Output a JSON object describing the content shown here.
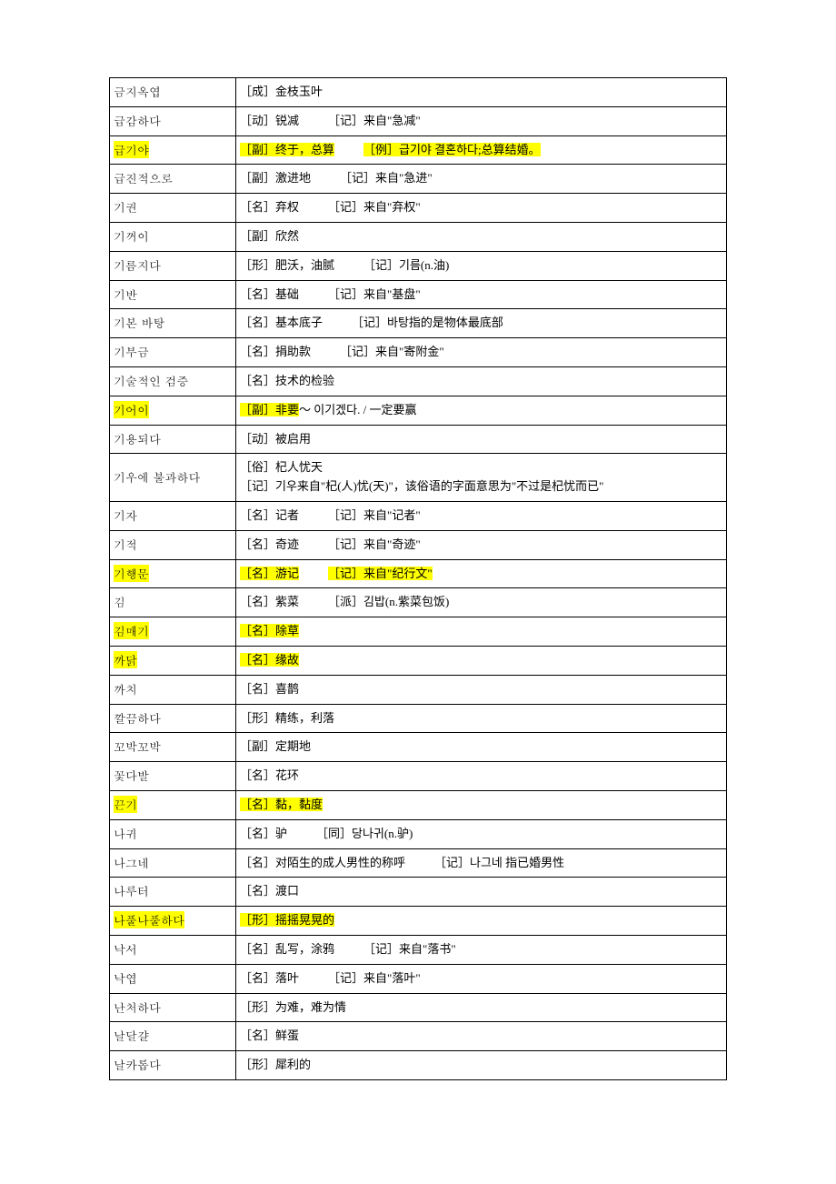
{
  "rows": [
    {
      "term": "금지옥엽",
      "term_hl": false,
      "def_parts": [
        {
          "text": "［成］金枝玉叶",
          "hl": false
        }
      ]
    },
    {
      "term": "급감하다",
      "term_hl": false,
      "def_parts": [
        {
          "text": "［动］锐减",
          "hl": false
        },
        {
          "gap": true
        },
        {
          "text": "［记］来自\"急减\"",
          "hl": false
        }
      ]
    },
    {
      "term": "급기야",
      "term_hl": true,
      "def_parts": [
        {
          "text": "［副］终于，总算",
          "hl": true
        },
        {
          "gap": true
        },
        {
          "text": "［例］급기야 결혼하다;总算结婚。",
          "hl": true
        }
      ]
    },
    {
      "term": "급진적으로",
      "term_hl": false,
      "def_parts": [
        {
          "text": "［副］激进地",
          "hl": false
        },
        {
          "gap": true
        },
        {
          "text": "［记］来自\"急进\"",
          "hl": false
        }
      ]
    },
    {
      "term": "기권",
      "term_hl": false,
      "def_parts": [
        {
          "text": "［名］弃权",
          "hl": false
        },
        {
          "gap": true
        },
        {
          "text": "［记］来自\"弃权\"",
          "hl": false
        }
      ]
    },
    {
      "term": "기꺼이",
      "term_hl": false,
      "def_parts": [
        {
          "text": "［副］欣然",
          "hl": false
        }
      ]
    },
    {
      "term": "기름지다",
      "term_hl": false,
      "def_parts": [
        {
          "text": "［形］肥沃，油腻",
          "hl": false
        },
        {
          "gap": true
        },
        {
          "text": "［记］기름(n.油)",
          "hl": false
        }
      ]
    },
    {
      "term": "기반",
      "term_hl": false,
      "def_parts": [
        {
          "text": "［名］基础",
          "hl": false
        },
        {
          "gap": true
        },
        {
          "text": "［记］来自\"基盘\"",
          "hl": false
        }
      ]
    },
    {
      "term": "기본 바탕",
      "term_hl": false,
      "def_parts": [
        {
          "text": "［名］基本底子",
          "hl": false
        },
        {
          "gap": true
        },
        {
          "text": "［记］바탕指的是物体最底部",
          "hl": false
        }
      ]
    },
    {
      "term": "기부금",
      "term_hl": false,
      "def_parts": [
        {
          "text": "［名］捐助款",
          "hl": false
        },
        {
          "gap": true
        },
        {
          "text": "［记］来自\"寄附金\"",
          "hl": false
        }
      ]
    },
    {
      "term": "기술적인 검증",
      "term_hl": false,
      "def_parts": [
        {
          "text": "［名］技术的检验",
          "hl": false
        }
      ]
    },
    {
      "term": "기어이",
      "term_hl": true,
      "def_parts": [
        {
          "text": "［副］非要",
          "hl": true
        },
        {
          "text": "～ 이기겠다. / 一定要赢",
          "hl": false
        }
      ]
    },
    {
      "term": "기용되다",
      "term_hl": false,
      "def_parts": [
        {
          "text": "［动］被启用",
          "hl": false
        }
      ]
    },
    {
      "term": "기우에 불과하다",
      "term_hl": false,
      "def_parts": [
        {
          "text": "［俗］杞人忧天",
          "hl": false
        },
        {
          "br": true
        },
        {
          "text": "［记］기우来自\"杞(人)忧(天)\"，该俗语的字面意思为\"不过是杞忧而已\"",
          "hl": false
        }
      ]
    },
    {
      "term": "기자",
      "term_hl": false,
      "def_parts": [
        {
          "text": "［名］记者",
          "hl": false
        },
        {
          "gap": true
        },
        {
          "text": "［记］来自\"记者\"",
          "hl": false
        }
      ]
    },
    {
      "term": "기적",
      "term_hl": false,
      "def_parts": [
        {
          "text": "［名］奇迹",
          "hl": false
        },
        {
          "gap": true
        },
        {
          "text": "［记］来自\"奇迹\"",
          "hl": false
        }
      ]
    },
    {
      "term": "기행문",
      "term_hl": true,
      "def_parts": [
        {
          "text": "［名］游记",
          "hl": true
        },
        {
          "gap": true
        },
        {
          "text": "［记］来自\"纪行文\"",
          "hl": true
        }
      ]
    },
    {
      "term": "김",
      "term_hl": false,
      "def_parts": [
        {
          "text": "［名］紫菜",
          "hl": false
        },
        {
          "gap": true
        },
        {
          "text": "［派］김밥(n.紫菜包饭)",
          "hl": false
        }
      ]
    },
    {
      "term": "김매기",
      "term_hl": true,
      "def_parts": [
        {
          "text": "［名］除草",
          "hl": true
        }
      ]
    },
    {
      "term": "까닭",
      "term_hl": true,
      "def_parts": [
        {
          "text": "［名］缘故",
          "hl": true
        }
      ]
    },
    {
      "term": "까치",
      "term_hl": false,
      "def_parts": [
        {
          "text": "［名］喜鹊",
          "hl": false
        }
      ]
    },
    {
      "term": "깔끔하다",
      "term_hl": false,
      "def_parts": [
        {
          "text": "［形］精练，利落",
          "hl": false
        }
      ]
    },
    {
      "term": "꼬박꼬박",
      "term_hl": false,
      "def_parts": [
        {
          "text": "［副］定期地",
          "hl": false
        }
      ]
    },
    {
      "term": "꽃다발",
      "term_hl": false,
      "def_parts": [
        {
          "text": "［名］花环",
          "hl": false
        }
      ]
    },
    {
      "term": "끈기",
      "term_hl": true,
      "def_parts": [
        {
          "text": "［名］黏，黏度",
          "hl": true
        }
      ]
    },
    {
      "term": "나귀",
      "term_hl": false,
      "def_parts": [
        {
          "text": "［名］驴",
          "hl": false
        },
        {
          "gap": true
        },
        {
          "text": "［同］당나귀(n.驴)",
          "hl": false
        }
      ]
    },
    {
      "term": "나그네",
      "term_hl": false,
      "def_parts": [
        {
          "text": "［名］对陌生的成人男性的称呼",
          "hl": false
        },
        {
          "gap": true
        },
        {
          "text": "［记］나그네 指已婚男性",
          "hl": false
        }
      ]
    },
    {
      "term": "나루터",
      "term_hl": false,
      "def_parts": [
        {
          "text": "［名］渡口",
          "hl": false
        }
      ]
    },
    {
      "term": "나풀나풀하다",
      "term_hl": true,
      "def_parts": [
        {
          "text": "［形］摇摇晃晃的",
          "hl": true
        }
      ]
    },
    {
      "term": "낙서",
      "term_hl": false,
      "def_parts": [
        {
          "text": "［名］乱写，涂鸦",
          "hl": false
        },
        {
          "gap": true
        },
        {
          "text": "［记］来自\"落书\"",
          "hl": false
        }
      ]
    },
    {
      "term": "낙엽",
      "term_hl": false,
      "def_parts": [
        {
          "text": "［名］落叶",
          "hl": false
        },
        {
          "gap": true
        },
        {
          "text": "［记］来自\"落叶\"",
          "hl": false
        }
      ]
    },
    {
      "term": "난처하다",
      "term_hl": false,
      "def_parts": [
        {
          "text": "［形］为难，难为情",
          "hl": false
        }
      ]
    },
    {
      "term": "날달걀",
      "term_hl": false,
      "def_parts": [
        {
          "text": "［名］鲜蛋",
          "hl": false
        }
      ]
    },
    {
      "term": "날카롭다",
      "term_hl": false,
      "def_parts": [
        {
          "text": "［形］犀利的",
          "hl": false
        }
      ]
    }
  ]
}
